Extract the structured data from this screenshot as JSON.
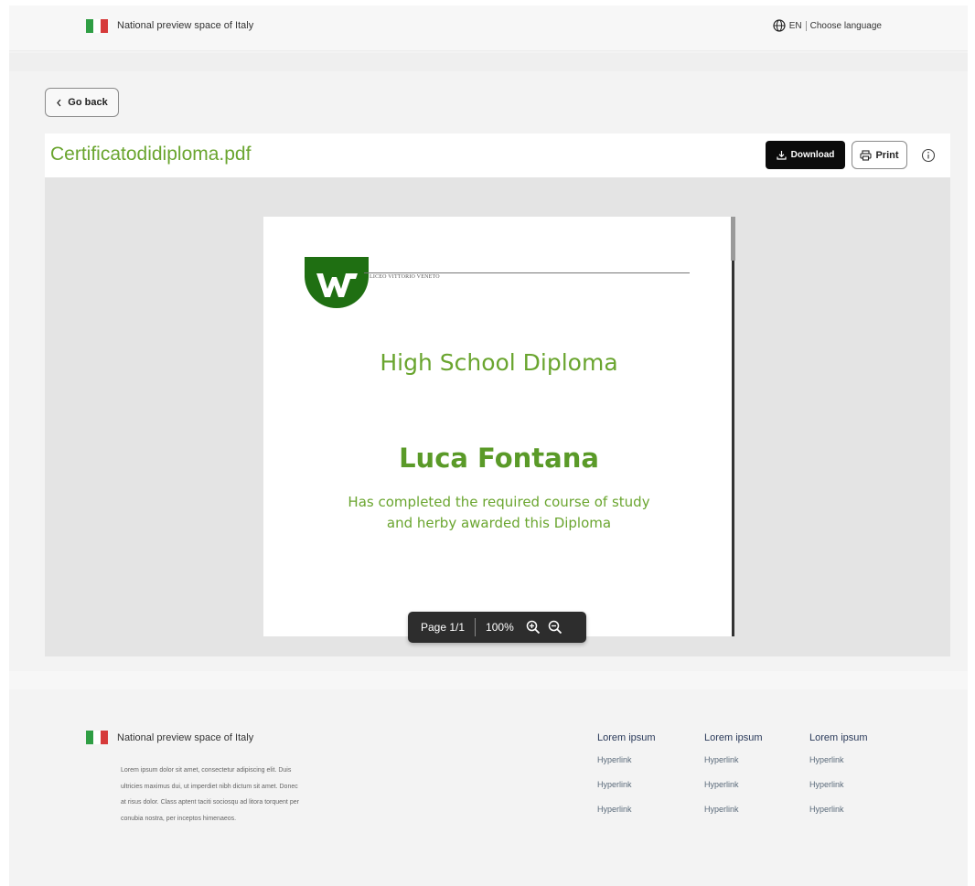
{
  "header": {
    "site_name": "National preview space of Italy",
    "lang_code": "EN",
    "lang_label": "Choose language"
  },
  "nav": {
    "go_back": "Go back"
  },
  "viewer": {
    "file_name": "Certificatodidiploma.pdf",
    "download_label": "Download",
    "print_label": "Print",
    "page_indicator": "Page 1/1",
    "zoom_level": "100%"
  },
  "document": {
    "letterhead": "LICEO VITTORIO VENETO",
    "title": "High School Diploma",
    "recipient": "Luca Fontana",
    "description_line1": "Has completed the required course of study",
    "description_line2": "and herby awarded this Diploma"
  },
  "footer": {
    "site_name": "National preview space of Italy",
    "text": "Lorem ipsum dolor sit amet, consectetur adipiscing elit. Duis ultricies maximus dui, ut imperdiet nibh dictum sit amet. Donec at risus dolor. Class aptent taciti sociosqu ad litora torquent per conubia nostra, per inceptos himenaeos.",
    "columns": [
      {
        "title": "Lorem ipsum",
        "links": [
          "Hyperlink",
          "Hyperlink",
          "Hyperlink"
        ]
      },
      {
        "title": "Lorem ipsum",
        "links": [
          "Hyperlink",
          "Hyperlink",
          "Hyperlink"
        ]
      },
      {
        "title": "Lorem ipsum",
        "links": [
          "Hyperlink",
          "Hyperlink",
          "Hyperlink"
        ]
      }
    ]
  },
  "colors": {
    "accent_green": "#6aa52f",
    "logo_green": "#1f6f12",
    "dark_button": "#0b0b0b"
  }
}
